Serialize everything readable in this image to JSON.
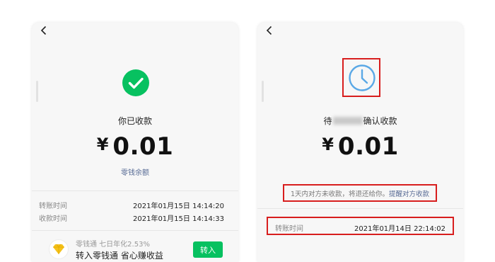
{
  "left": {
    "status_title": "你已收款",
    "currency": "¥",
    "amount": "0.01",
    "change_balance_link": "零钱余额",
    "rows": [
      {
        "label": "转账时间",
        "value": "2021年01月15日 14:14:20"
      },
      {
        "label": "收款时间",
        "value": "2021年01月15日 14:14:33"
      }
    ],
    "promo": {
      "subtitle": "零钱通 七日年化2.53%",
      "title": "转入零钱通 省心赚收益",
      "button": "转入"
    }
  },
  "right": {
    "title_prefix": "待",
    "title_suffix": "确认收款",
    "currency": "¥",
    "amount": "0.01",
    "notice_text": "1天内对方未收款，将退还给你。",
    "notice_link": "提醒对方收款",
    "rows": [
      {
        "label": "转账时间",
        "value": "2021年01月14日 22:14:02"
      }
    ]
  },
  "colors": {
    "accent_green": "#07c160",
    "link_blue": "#576b95",
    "clock_blue": "#5aa8e6",
    "highlight_red": "#d81e1e"
  },
  "icons": {
    "back": "chevron-left-icon",
    "success": "check-circle-icon",
    "pending": "clock-icon",
    "promo": "diamond-icon"
  }
}
